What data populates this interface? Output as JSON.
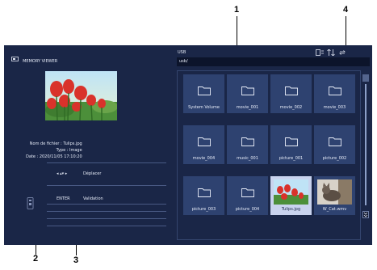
{
  "app": {
    "title": "MEMORY VIEWER"
  },
  "preview": {
    "file_name": "Nom de fichier : Tulips.jpg",
    "type": "Type : Image",
    "date": "Date : 2020/11/05 17:10:20"
  },
  "help": {
    "move_label": "Déplacer",
    "enter_key": "ENTER",
    "enter_label": "Validation"
  },
  "browser": {
    "source_label": "USB",
    "path": "usb/",
    "items": [
      {
        "label": "System Volume",
        "kind": "folder"
      },
      {
        "label": "movie_001",
        "kind": "folder"
      },
      {
        "label": "movie_002",
        "kind": "folder"
      },
      {
        "label": "movie_003",
        "kind": "folder"
      },
      {
        "label": "movie_004",
        "kind": "folder"
      },
      {
        "label": "music_001",
        "kind": "folder"
      },
      {
        "label": "picture_001",
        "kind": "folder"
      },
      {
        "label": "picture_002",
        "kind": "folder"
      },
      {
        "label": "picture_003",
        "kind": "folder"
      },
      {
        "label": "picture_004",
        "kind": "folder"
      },
      {
        "label": "Tulips.jpg",
        "kind": "image",
        "selected": true
      },
      {
        "label": "W_Cat.wmv",
        "kind": "video"
      }
    ]
  },
  "toolbar_icons": [
    "thumbnail-view-icon",
    "sort-icon",
    "repeat-icon"
  ],
  "annotations": {
    "a1": "1",
    "a2": "2",
    "a3": "3",
    "a4": "4"
  },
  "colors": {
    "background": "#1a2647",
    "tile": "#2e4270",
    "selected_tile": "#c9d3ee",
    "text": "#e7ecf8"
  }
}
